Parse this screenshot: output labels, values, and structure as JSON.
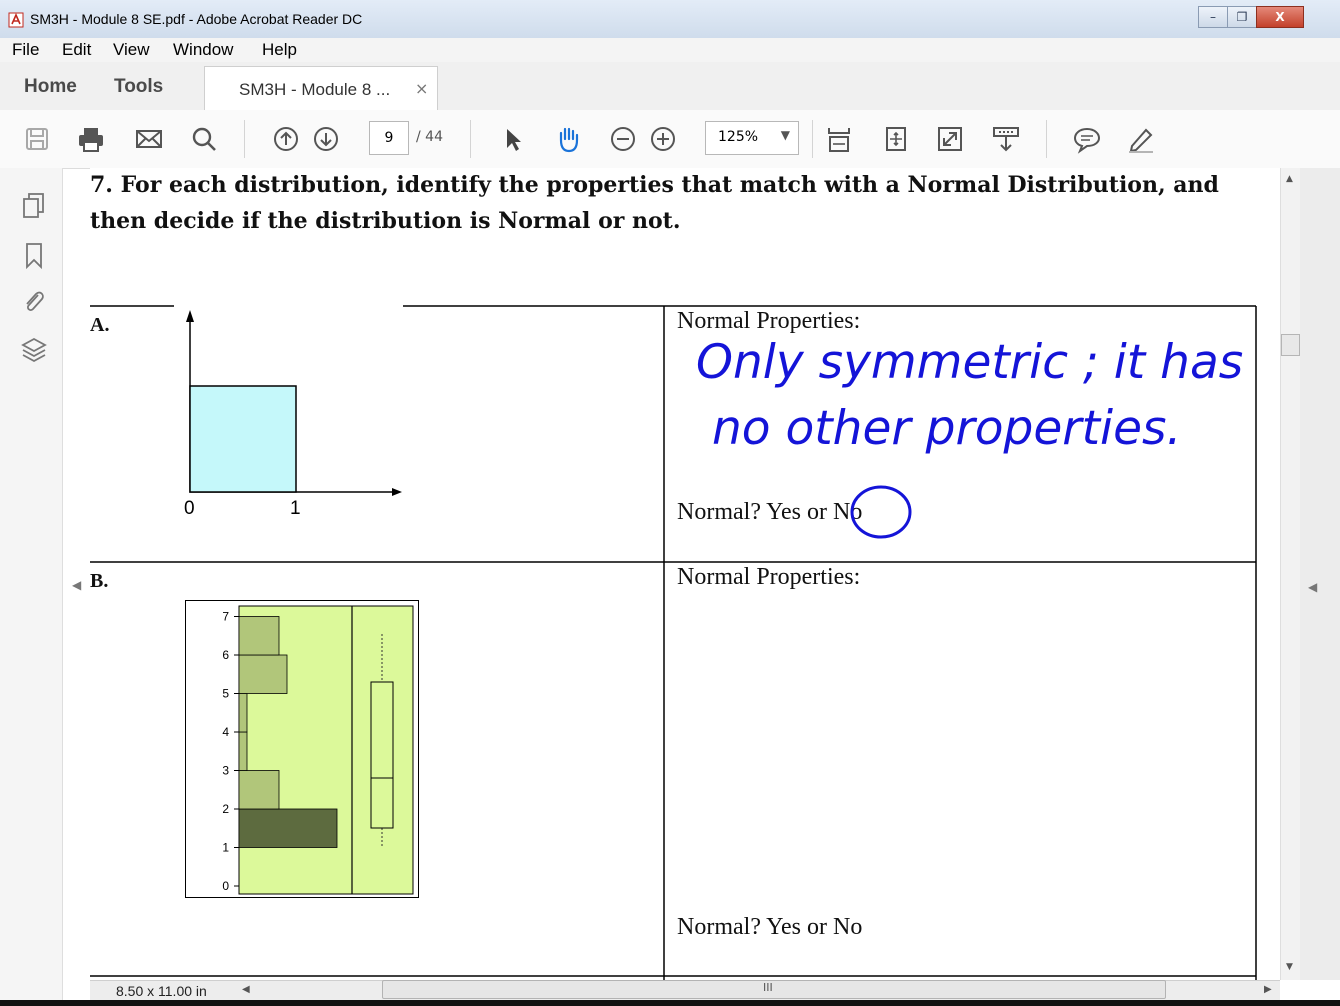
{
  "window": {
    "title": "SM3H - Module 8 SE.pdf - Adobe Acrobat Reader DC",
    "buttons": [
      "minimize-icon",
      "restore-icon",
      "close-icon"
    ]
  },
  "menu": [
    "File",
    "Edit",
    "View",
    "Window",
    "Help"
  ],
  "tabs": {
    "home": "Home",
    "tools": "Tools",
    "document": "SM3H - Module 8 ...",
    "close_glyph": "×"
  },
  "toolbar": {
    "icons_left": [
      "save-icon",
      "print-icon",
      "email-icon",
      "search-icon"
    ],
    "page_current": "9",
    "page_total": "/ 44",
    "zoom": "125%",
    "icons_right": [
      "select-arrow-icon",
      "hand-icon",
      "zoom-out-icon",
      "zoom-in-icon",
      "fit-page-icon",
      "rotate-icon",
      "full-screen-icon",
      "read-mode-icon",
      "comment-icon",
      "highlight-pen-icon"
    ]
  },
  "left_nav": [
    "pages-icon",
    "bookmark-icon",
    "attachment-icon",
    "layers-icon"
  ],
  "document": {
    "question_line1": "7.  For each distribution, identify the properties that match with a Normal Distribution, and",
    "question_line2": "then decide if the distribution is Normal or not.",
    "part_a": {
      "label": "A.",
      "axis_labels": [
        "0",
        "1"
      ],
      "properties_label": "Normal Properties:",
      "handwriting_line1": "Only symmetric ; it has",
      "handwriting_line2": "no other properties.",
      "normal_question": "Normal? Yes or No",
      "circled_answer": "No"
    },
    "part_b": {
      "label": "B.",
      "y_ticks": [
        "7",
        "6",
        "5",
        "4",
        "3",
        "2",
        "1",
        "0"
      ],
      "properties_label": "Normal Properties:",
      "normal_question": "Normal? Yes or No"
    }
  },
  "status": {
    "page_size": "8.50 x 11.00 in",
    "scroll_grip": "III"
  },
  "colors": {
    "uniform_fill": "#c5f8fa",
    "panel_fill": "#dcf99a",
    "bar_light": "#b1c67a",
    "bar_dark": "#5d6b3f",
    "ink_blue": "#1414d8"
  }
}
